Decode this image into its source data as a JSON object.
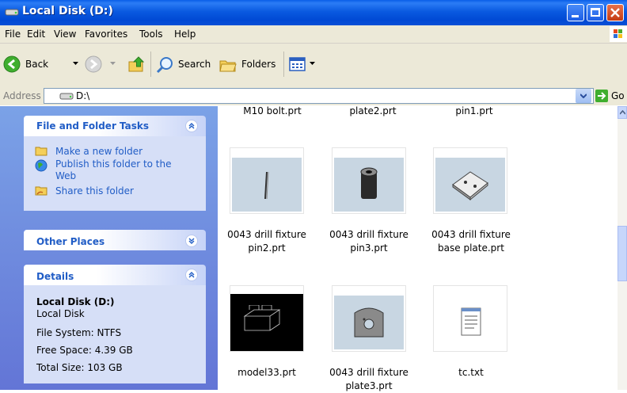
{
  "window": {
    "title": "Local Disk (D:)"
  },
  "menu": {
    "items": [
      "File",
      "Edit",
      "View",
      "Favorites",
      "Tools",
      "Help"
    ]
  },
  "toolbar": {
    "back": "Back",
    "search": "Search",
    "folders": "Folders"
  },
  "address": {
    "label": "Address",
    "value": "D:\\",
    "go": "Go"
  },
  "tasks_panel": {
    "title": "File and Folder Tasks",
    "items": [
      "Make a new folder",
      "Publish this folder to the",
      "Web",
      "Share this folder"
    ]
  },
  "other_places": {
    "title": "Other Places"
  },
  "details": {
    "title": "Details",
    "name": "Local Disk (D:)",
    "type": "Local Disk",
    "fs": "File System: NTFS",
    "free": "Free Space: 4.39 GB",
    "total": "Total Size: 103 GB"
  },
  "files": {
    "top_row": [
      "M10 bolt.prt",
      "plate2.prt",
      "pin1.prt"
    ],
    "row2": [
      {
        "line1": "0043 drill fixture",
        "line2": "pin2.prt"
      },
      {
        "line1": "0043 drill fixture",
        "line2": "pin3.prt"
      },
      {
        "line1": "0043 drill fixture",
        "line2": "base plate.prt"
      }
    ],
    "row3": [
      {
        "line1": "model33.prt",
        "line2": ""
      },
      {
        "line1": "0043 drill fixture",
        "line2": "plate3.prt"
      },
      {
        "line1": "tc.txt",
        "line2": ""
      }
    ]
  }
}
